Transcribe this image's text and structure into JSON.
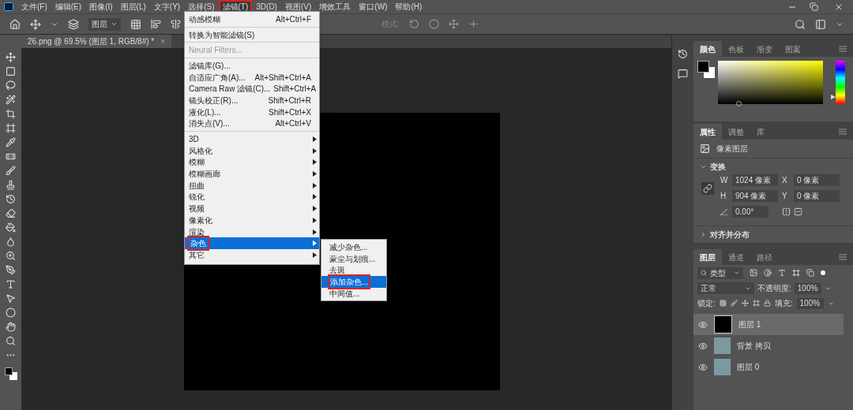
{
  "menu_bar": [
    {
      "label": "文件(F)",
      "selected": false,
      "highlighted": false
    },
    {
      "label": "编辑(E)",
      "selected": false,
      "highlighted": false
    },
    {
      "label": "图像(I)",
      "selected": false,
      "highlighted": false
    },
    {
      "label": "图层(L)",
      "selected": false,
      "highlighted": false
    },
    {
      "label": "文字(Y)",
      "selected": false,
      "highlighted": false
    },
    {
      "label": "选择(S)",
      "selected": false,
      "highlighted": false
    },
    {
      "label": "滤镜(T)",
      "selected": true,
      "highlighted": true
    },
    {
      "label": "3D(D)",
      "selected": false,
      "highlighted": false
    },
    {
      "label": "视图(V)",
      "selected": false,
      "highlighted": false
    },
    {
      "label": "增效工具",
      "selected": false,
      "highlighted": false
    },
    {
      "label": "窗口(W)",
      "selected": false,
      "highlighted": false
    },
    {
      "label": "帮助(H)",
      "selected": false,
      "highlighted": false
    }
  ],
  "options_bar": {
    "layer_select": "图层",
    "mode_label": "模式:"
  },
  "document_tab": {
    "title": "26.png @ 69.5% (图层 1, RGB/8#) *",
    "close": "×"
  },
  "filter_menu": {
    "groups": [
      [
        {
          "label": "动感模糊",
          "shortcut": "Alt+Ctrl+F",
          "submenu": false,
          "disabled": false,
          "selected": false,
          "highlighted": false
        }
      ],
      [
        {
          "label": "转换为智能滤镜(S)",
          "submenu": false,
          "disabled": false,
          "selected": false,
          "highlighted": false
        }
      ],
      [
        {
          "label": "Neural Filters...",
          "submenu": false,
          "disabled": true,
          "selected": false,
          "highlighted": false
        }
      ],
      [
        {
          "label": "滤镜库(G)...",
          "submenu": false,
          "disabled": false,
          "selected": false,
          "highlighted": false
        },
        {
          "label": "自适应广角(A)...",
          "shortcut": "Alt+Shift+Ctrl+A",
          "submenu": false,
          "disabled": false,
          "selected": false,
          "highlighted": false
        },
        {
          "label": "Camera Raw 滤镜(C)...",
          "shortcut": "Shift+Ctrl+A",
          "submenu": false,
          "disabled": false,
          "selected": false,
          "highlighted": false
        },
        {
          "label": "镜头校正(R)...",
          "shortcut": "Shift+Ctrl+R",
          "submenu": false,
          "disabled": false,
          "selected": false,
          "highlighted": false
        },
        {
          "label": "液化(L)...",
          "shortcut": "Shift+Ctrl+X",
          "submenu": false,
          "disabled": false,
          "selected": false,
          "highlighted": false
        },
        {
          "label": "消失点(V)...",
          "shortcut": "Alt+Ctrl+V",
          "submenu": false,
          "disabled": false,
          "selected": false,
          "highlighted": false
        }
      ],
      [
        {
          "label": "3D",
          "submenu": true,
          "disabled": false,
          "selected": false,
          "highlighted": false
        },
        {
          "label": "风格化",
          "submenu": true,
          "disabled": false,
          "selected": false,
          "highlighted": false
        },
        {
          "label": "模糊",
          "submenu": true,
          "disabled": false,
          "selected": false,
          "highlighted": false
        },
        {
          "label": "模糊画廊",
          "submenu": true,
          "disabled": false,
          "selected": false,
          "highlighted": false
        },
        {
          "label": "扭曲",
          "submenu": true,
          "disabled": false,
          "selected": false,
          "highlighted": false
        },
        {
          "label": "锐化",
          "submenu": true,
          "disabled": false,
          "selected": false,
          "highlighted": false
        },
        {
          "label": "视频",
          "submenu": true,
          "disabled": false,
          "selected": false,
          "highlighted": false
        },
        {
          "label": "像素化",
          "submenu": true,
          "disabled": false,
          "selected": false,
          "highlighted": false
        },
        {
          "label": "渲染",
          "submenu": true,
          "disabled": false,
          "selected": false,
          "highlighted": false
        },
        {
          "label": "杂色",
          "submenu": true,
          "disabled": false,
          "selected": true,
          "highlighted": true
        },
        {
          "label": "其它",
          "submenu": true,
          "disabled": false,
          "selected": false,
          "highlighted": false
        }
      ]
    ]
  },
  "noise_submenu": [
    {
      "label": "减少杂色...",
      "selected": false,
      "highlighted": false
    },
    {
      "label": "蒙尘与划痕...",
      "selected": false,
      "highlighted": false
    },
    {
      "label": "去斑",
      "selected": false,
      "highlighted": false
    },
    {
      "label": "添加杂色...",
      "selected": true,
      "highlighted": true
    },
    {
      "label": "中间值...",
      "selected": false,
      "highlighted": false
    }
  ],
  "color_panel": {
    "hue_slider": {
      "level": 0.83
    },
    "tabs": [
      {
        "label": "颜色",
        "selected": true
      },
      {
        "label": "色板",
        "selected": false
      },
      {
        "label": "渐变",
        "selected": false
      },
      {
        "label": "图案",
        "selected": false
      }
    ]
  },
  "properties_panel": {
    "tabs": [
      {
        "label": "属性",
        "selected": true
      },
      {
        "label": "调整",
        "selected": false
      },
      {
        "label": "库",
        "selected": false
      }
    ],
    "layer_kind": "像素图层",
    "transform": {
      "title": "变换",
      "expanded": true,
      "w_label": "W",
      "w": "1024 像素",
      "x_label": "X",
      "x": "0 像素",
      "h_label": "H",
      "h": "904 像素",
      "y_label": "Y",
      "y": "0 像素",
      "angle": "0.00°"
    },
    "align": {
      "title": "对齐并分布",
      "expanded": false
    }
  },
  "layers_panel": {
    "tabs": [
      {
        "label": "图层",
        "selected": true
      },
      {
        "label": "通道",
        "selected": false
      },
      {
        "label": "路径",
        "selected": false
      }
    ],
    "filter": "类型",
    "blend_mode": "正常",
    "opacity_label": "不透明度:",
    "opacity": "100%",
    "lock_label": "锁定:",
    "fill_label": "填充:",
    "fill": "100%",
    "layers": [
      {
        "name": "图层 1",
        "kind": "fill",
        "selected": true,
        "visible": true
      },
      {
        "name": "背景 拷贝",
        "kind": "photo",
        "selected": false,
        "visible": true
      },
      {
        "name": "图层 0",
        "kind": "photo",
        "selected": false,
        "visible": true
      }
    ]
  }
}
